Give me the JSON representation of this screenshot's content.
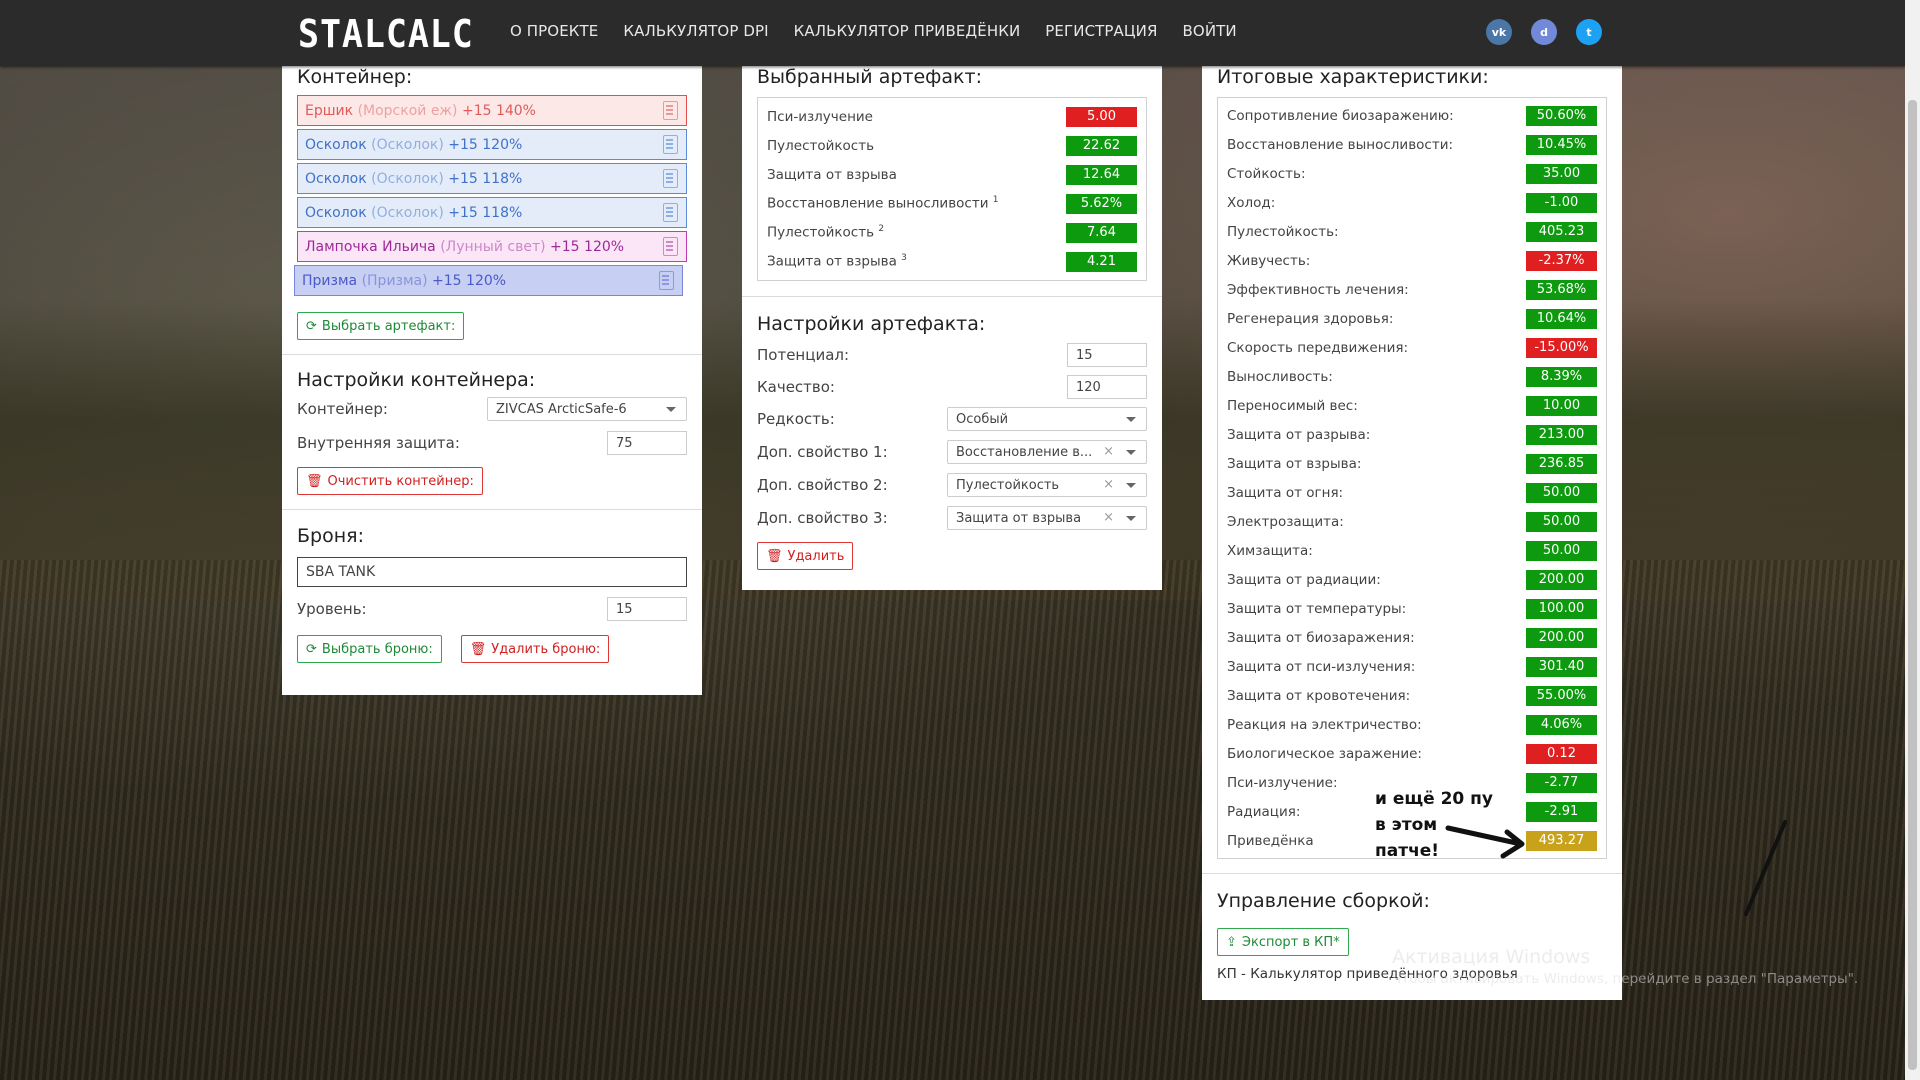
{
  "nav": {
    "logo": "STALCALC",
    "links": [
      "О ПРОЕКТЕ",
      "КАЛЬКУЛЯТОР DPI",
      "КАЛЬКУЛЯТОР ПРИВЕДЁНКИ",
      "РЕГИСТРАЦИЯ",
      "ВОЙТИ"
    ],
    "social": [
      {
        "icon": "vk-icon",
        "text": "vk"
      },
      {
        "icon": "discord-icon",
        "text": "d"
      },
      {
        "icon": "twitter-icon",
        "text": "t"
      }
    ]
  },
  "container": {
    "title": "Контейнер:",
    "artifacts": [
      {
        "name": "Ершик",
        "alt": "(Морской еж)",
        "level": "+15 140%",
        "color": "red"
      },
      {
        "name": "Осколок",
        "alt": "(Осколок)",
        "level": "+15 120%",
        "color": "blue"
      },
      {
        "name": "Осколок",
        "alt": "(Осколок)",
        "level": "+15 118%",
        "color": "blue"
      },
      {
        "name": "Осколок",
        "alt": "(Осколок)",
        "level": "+15 118%",
        "color": "blue"
      },
      {
        "name": "Лампочка Ильича",
        "alt": "(Лунный свет)",
        "level": "+15 120%",
        "color": "purple"
      },
      {
        "name": "Призма",
        "alt": "(Призма)",
        "level": "+15 120%",
        "color": "indigo"
      }
    ],
    "choose_btn": "Выбрать артефакт:"
  },
  "container_settings": {
    "title": "Настройки контейнера:",
    "container_label": "Контейнер:",
    "container_value": "ZIVCAS ArcticSafe-6",
    "inner_protection_label": "Внутренняя защита:",
    "inner_protection_value": "75",
    "clear_btn": "Очистить контейнер:"
  },
  "armor": {
    "title": "Броня:",
    "name_value": "SBA TANK",
    "level_label": "Уровень:",
    "level_value": "15",
    "choose_btn": "Выбрать броню:",
    "delete_btn": "Удалить броню:"
  },
  "selected_artifact": {
    "title": "Выбранный артефакт:",
    "stats": [
      {
        "label": "Пси-излучение",
        "sup": "",
        "value": "5.00",
        "color": "red"
      },
      {
        "label": "Пулестойкость",
        "sup": "",
        "value": "22.62",
        "color": "green"
      },
      {
        "label": "Защита от взрыва",
        "sup": "",
        "value": "12.64",
        "color": "green"
      },
      {
        "label": "Восстановление выносливости",
        "sup": "1",
        "value": "5.62%",
        "color": "green"
      },
      {
        "label": "Пулестойкость",
        "sup": "2",
        "value": "7.64",
        "color": "green"
      },
      {
        "label": "Защита от взрыва",
        "sup": "3",
        "value": "4.21",
        "color": "green"
      }
    ]
  },
  "artifact_settings": {
    "title": "Настройки артефакта:",
    "potential_label": "Потенциал:",
    "potential_value": "15",
    "quality_label": "Качество:",
    "quality_value": "120",
    "rarity_label": "Редкость:",
    "rarity_value": "Особый",
    "prop1_label": "Доп. свойство 1:",
    "prop1_value": "Восстановление в...",
    "prop2_label": "Доп. свойство 2:",
    "prop2_value": "Пулестойкость",
    "prop3_label": "Доп. свойство 3:",
    "prop3_value": "Защита от взрыва",
    "delete_btn": "Удалить"
  },
  "totals": {
    "title": "Итоговые характеристики:",
    "stats": [
      {
        "label": "Сопротивление биозаражению:",
        "value": "50.60%",
        "color": "green"
      },
      {
        "label": "Восстановление выносливости:",
        "value": "10.45%",
        "color": "green"
      },
      {
        "label": "Стойкость:",
        "value": "35.00",
        "color": "green"
      },
      {
        "label": "Холод:",
        "value": "-1.00",
        "color": "green"
      },
      {
        "label": "Пулестойкость:",
        "value": "405.23",
        "color": "green"
      },
      {
        "label": "Живучесть:",
        "value": "-2.37%",
        "color": "red"
      },
      {
        "label": "Эффективность лечения:",
        "value": "53.68%",
        "color": "green"
      },
      {
        "label": "Регенерация здоровья:",
        "value": "10.64%",
        "color": "green"
      },
      {
        "label": "Скорость передвижения:",
        "value": "-15.00%",
        "color": "red"
      },
      {
        "label": "Выносливость:",
        "value": "8.39%",
        "color": "green"
      },
      {
        "label": "Переносимый вес:",
        "value": "10.00",
        "color": "green"
      },
      {
        "label": "Защита от разрыва:",
        "value": "213.00",
        "color": "green"
      },
      {
        "label": "Защита от взрыва:",
        "value": "236.85",
        "color": "green"
      },
      {
        "label": "Защита от огня:",
        "value": "50.00",
        "color": "green"
      },
      {
        "label": "Электрозащита:",
        "value": "50.00",
        "color": "green"
      },
      {
        "label": "Химзащита:",
        "value": "50.00",
        "color": "green"
      },
      {
        "label": "Защита от радиации:",
        "value": "200.00",
        "color": "green"
      },
      {
        "label": "Защита от температуры:",
        "value": "100.00",
        "color": "green"
      },
      {
        "label": "Защита от биозаражения:",
        "value": "200.00",
        "color": "green"
      },
      {
        "label": "Защита от пси-излучения:",
        "value": "301.40",
        "color": "green"
      },
      {
        "label": "Защита от кровотечения:",
        "value": "55.00%",
        "color": "green"
      },
      {
        "label": "Реакция на электричество:",
        "value": "4.06%",
        "color": "green"
      },
      {
        "label": "Биологическое заражение:",
        "value": "0.12",
        "color": "red"
      },
      {
        "label": "Пси-излучение:",
        "value": "-2.77",
        "color": "green"
      },
      {
        "label": "Радиация:",
        "value": "-2.91",
        "color": "green"
      },
      {
        "label": "Приведёнка",
        "value": "493.27",
        "color": "yellow"
      }
    ],
    "annotation_lines": [
      "и ещё 20 пу",
      "в этом",
      "патче!"
    ]
  },
  "build": {
    "title": "Управление сборкой:",
    "export_btn": "Экспорт в КП*",
    "footnote": "КП - Калькулятор приведённого здоровья"
  },
  "windows": {
    "line1": "Активация Windows",
    "line2": "Чтобы активировать Windows, перейдите в раздел \"Параметры\"."
  },
  "colors": {
    "green": "#0e9a0e",
    "red": "#e02020",
    "yellow": "#c9a21c"
  }
}
